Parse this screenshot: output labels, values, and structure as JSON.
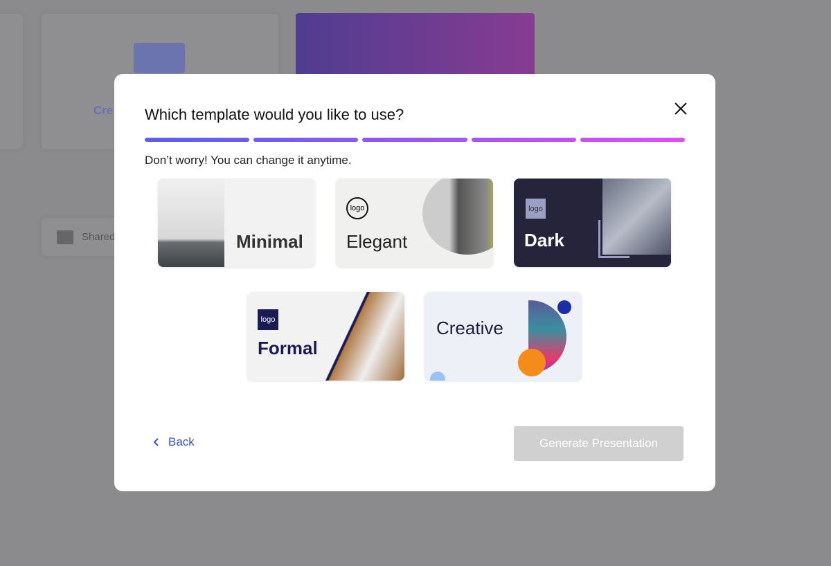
{
  "background": {
    "create_label": "Cre",
    "shared_label": "Shared"
  },
  "modal": {
    "title": "Which template would you like to use?",
    "subtitle": "Don’t worry! You can change it anytime.",
    "progress_colors": [
      "#5a5fe6",
      "#7b5ce9",
      "#9a57ec",
      "#b353ee",
      "#d14ff1"
    ],
    "steps_completed": 5,
    "templates": [
      {
        "name": "Minimal"
      },
      {
        "name": "Elegant",
        "logo": "logo"
      },
      {
        "name": "Dark",
        "logo": "logo"
      },
      {
        "name": "Formal",
        "logo": "logo"
      },
      {
        "name": "Creative"
      }
    ],
    "back_label": "Back",
    "generate_label": "Generate Presentation"
  }
}
